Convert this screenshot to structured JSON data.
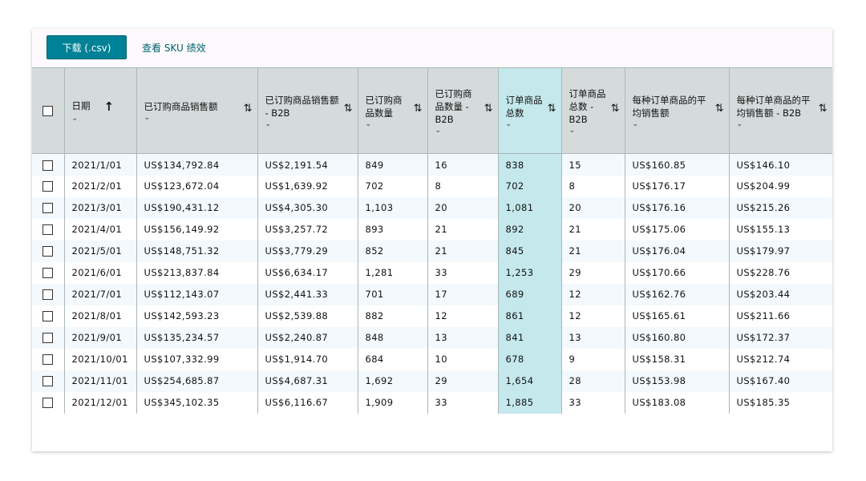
{
  "toolbar": {
    "download_label": "下载 (.csv)",
    "sku_link_label": "查看 SKU 绩效"
  },
  "colors": {
    "accent": "#008296",
    "header_bg": "#d5dbdb",
    "highlight": "#c4e8ec"
  },
  "table": {
    "columns": [
      {
        "label": "日期",
        "sort": "↑"
      },
      {
        "label": "已订购商品销售额",
        "sort": "⇅"
      },
      {
        "label": "已订购商品销售额 - B2B",
        "sort": "⇅"
      },
      {
        "label": "已订购商品数量",
        "sort": "⇅"
      },
      {
        "label": "已订购商品数量 - B2B",
        "sort": "⇅"
      },
      {
        "label": "订单商品总数",
        "sort": "⇅"
      },
      {
        "label": "订单商品总数 - B2B",
        "sort": "⇅"
      },
      {
        "label": "每种订单商品的平均销售额",
        "sort": "⇅"
      },
      {
        "label": "每种订单商品的平均销售额 - B2B",
        "sort": "⇅"
      }
    ],
    "rows": [
      [
        "2021/1/01",
        "US$134,792.84",
        "US$2,191.54",
        "849",
        "16",
        "838",
        "15",
        "US$160.85",
        "US$146.10"
      ],
      [
        "2021/2/01",
        "US$123,672.04",
        "US$1,639.92",
        "702",
        "8",
        "702",
        "8",
        "US$176.17",
        "US$204.99"
      ],
      [
        "2021/3/01",
        "US$190,431.12",
        "US$4,305.30",
        "1,103",
        "20",
        "1,081",
        "20",
        "US$176.16",
        "US$215.26"
      ],
      [
        "2021/4/01",
        "US$156,149.92",
        "US$3,257.72",
        "893",
        "21",
        "892",
        "21",
        "US$175.06",
        "US$155.13"
      ],
      [
        "2021/5/01",
        "US$148,751.32",
        "US$3,779.29",
        "852",
        "21",
        "845",
        "21",
        "US$176.04",
        "US$179.97"
      ],
      [
        "2021/6/01",
        "US$213,837.84",
        "US$6,634.17",
        "1,281",
        "33",
        "1,253",
        "29",
        "US$170.66",
        "US$228.76"
      ],
      [
        "2021/7/01",
        "US$112,143.07",
        "US$2,441.33",
        "701",
        "17",
        "689",
        "12",
        "US$162.76",
        "US$203.44"
      ],
      [
        "2021/8/01",
        "US$142,593.23",
        "US$2,539.88",
        "882",
        "12",
        "861",
        "12",
        "US$165.61",
        "US$211.66"
      ],
      [
        "2021/9/01",
        "US$135,234.57",
        "US$2,240.87",
        "848",
        "13",
        "841",
        "13",
        "US$160.80",
        "US$172.37"
      ],
      [
        "2021/10/01",
        "US$107,332.99",
        "US$1,914.70",
        "684",
        "10",
        "678",
        "9",
        "US$158.31",
        "US$212.74"
      ],
      [
        "2021/11/01",
        "US$254,685.87",
        "US$4,687.31",
        "1,692",
        "29",
        "1,654",
        "28",
        "US$153.98",
        "US$167.40"
      ],
      [
        "2021/12/01",
        "US$345,102.35",
        "US$6,116.67",
        "1,909",
        "33",
        "1,885",
        "33",
        "US$183.08",
        "US$185.35"
      ]
    ]
  }
}
